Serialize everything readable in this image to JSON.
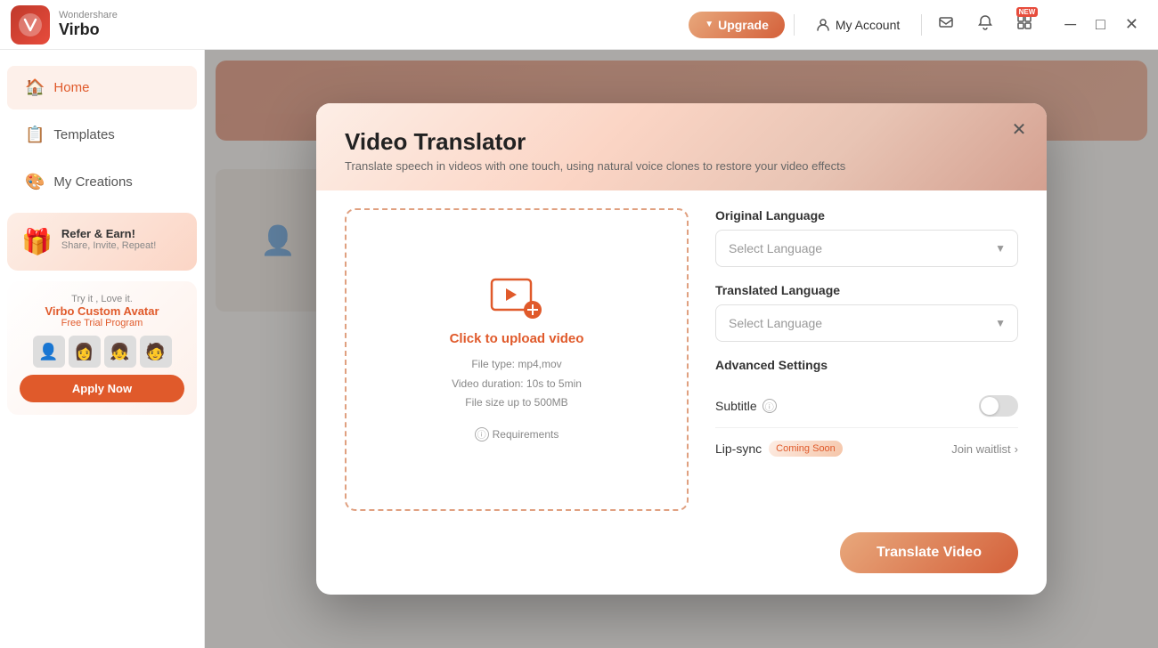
{
  "app": {
    "brand": "Wondershare",
    "name": "Virbo",
    "logo_char": "V"
  },
  "titlebar": {
    "upgrade_label": "Upgrade",
    "my_account_label": "My Account",
    "new_badge": "NEW",
    "icons": [
      "email",
      "bell",
      "grid",
      "minimize",
      "maximize",
      "close"
    ]
  },
  "sidebar": {
    "items": [
      {
        "id": "home",
        "label": "Home",
        "icon": "🏠",
        "active": true
      },
      {
        "id": "templates",
        "label": "Templates",
        "icon": "📋",
        "active": false
      },
      {
        "id": "my-creations",
        "label": "My Creations",
        "icon": "🎨",
        "active": false
      }
    ],
    "refer_card": {
      "icon": "🎁",
      "title": "Refer & Earn!",
      "subtitle": "Share, Invite, Repeat!"
    },
    "promo_card": {
      "try_label": "Try it , Love it.",
      "title": "Virbo Custom Avatar",
      "desc": "Free Trial Program",
      "apply_label": "Apply Now"
    }
  },
  "modal": {
    "title": "Video Translator",
    "subtitle": "Translate speech in videos with one touch, using natural voice clones to restore your video effects",
    "close_label": "✕",
    "upload": {
      "click_text": "Click to upload video",
      "file_type": "File type: mp4,mov",
      "duration": "Video duration: 10s to  5min",
      "file_size": "File size up to  500MB",
      "requirements_label": "Requirements"
    },
    "original_language": {
      "label": "Original Language",
      "placeholder": "Select Language"
    },
    "translated_language": {
      "label": "Translated Language",
      "placeholder": "Select Language"
    },
    "advanced_settings": {
      "label": "Advanced Settings",
      "subtitle_label": "Subtitle",
      "lipsync_label": "Lip-sync",
      "coming_soon": "Coming Soon",
      "join_waitlist": "Join  waitlist"
    },
    "translate_btn": "Translate Video"
  }
}
